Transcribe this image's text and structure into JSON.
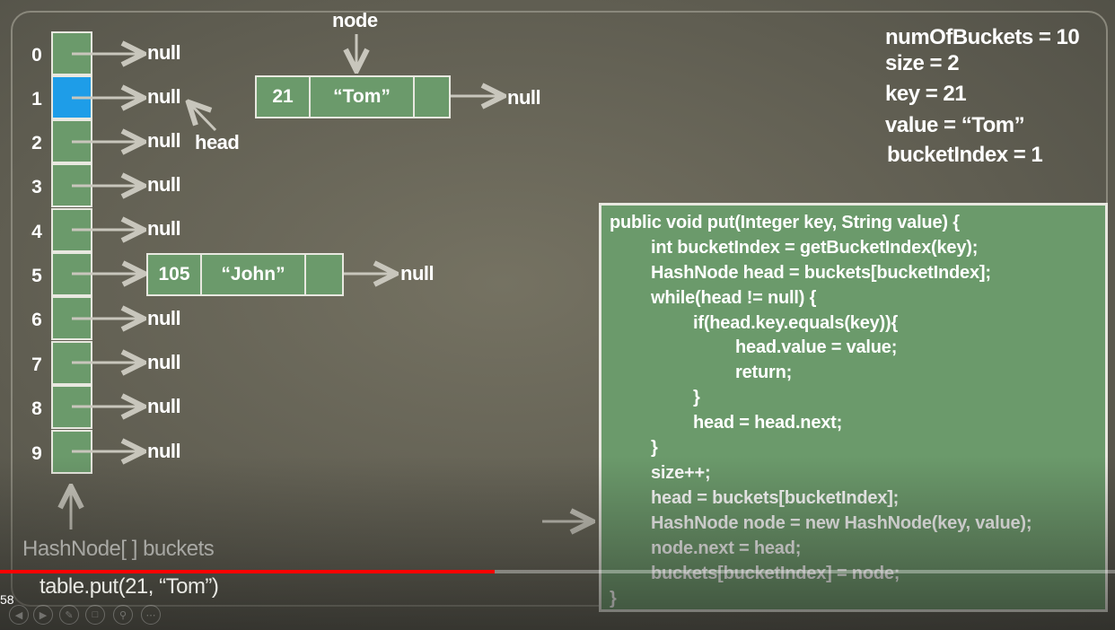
{
  "diagram": {
    "bucket_indices": [
      "0",
      "1",
      "2",
      "3",
      "4",
      "5",
      "6",
      "7",
      "8",
      "9"
    ],
    "highlighted_bucket": 1,
    "null_labels": {
      "b0": "null",
      "b1": "null",
      "b2": "null",
      "b3": "null",
      "b4": "null",
      "b6": "null",
      "b7": "null",
      "b8": "null",
      "b9": "null",
      "john_next": "null",
      "tom_next": "null"
    },
    "head_label": "head",
    "node_label": "node",
    "tom_node": {
      "key": "21",
      "value": "“Tom”"
    },
    "john_node": {
      "key": "105",
      "value": "“John”"
    },
    "buckets_label": "HashNode[ ] buckets",
    "call_label": "table.put(21, “Tom”)"
  },
  "state": {
    "num_buckets": "numOfBuckets = 10",
    "size": "size = 2",
    "key": "key = 21",
    "value": "value = “Tom”",
    "bucket_index": "bucketIndex = 1"
  },
  "code": {
    "lines": [
      "public void put(Integer key, String value) {",
      "int bucketIndex = getBucketIndex(key);",
      "HashNode head = buckets[bucketIndex];",
      "while(head != null) {",
      "if(head.key.equals(key)){",
      "head.value = value;",
      "return;",
      "}",
      "head = head.next;",
      "}",
      "size++;",
      "head = buckets[bucketIndex];",
      "HashNode node = new HashNode(key, value);",
      "node.next = head;",
      "buckets[bucketIndex] = node;",
      "}"
    ]
  },
  "player": {
    "time": "58",
    "progress": 0.444,
    "colors": {
      "progress": "#ff0000",
      "accent_bucket": "#1e9de8",
      "box_fill": "#6b9a6b"
    }
  }
}
